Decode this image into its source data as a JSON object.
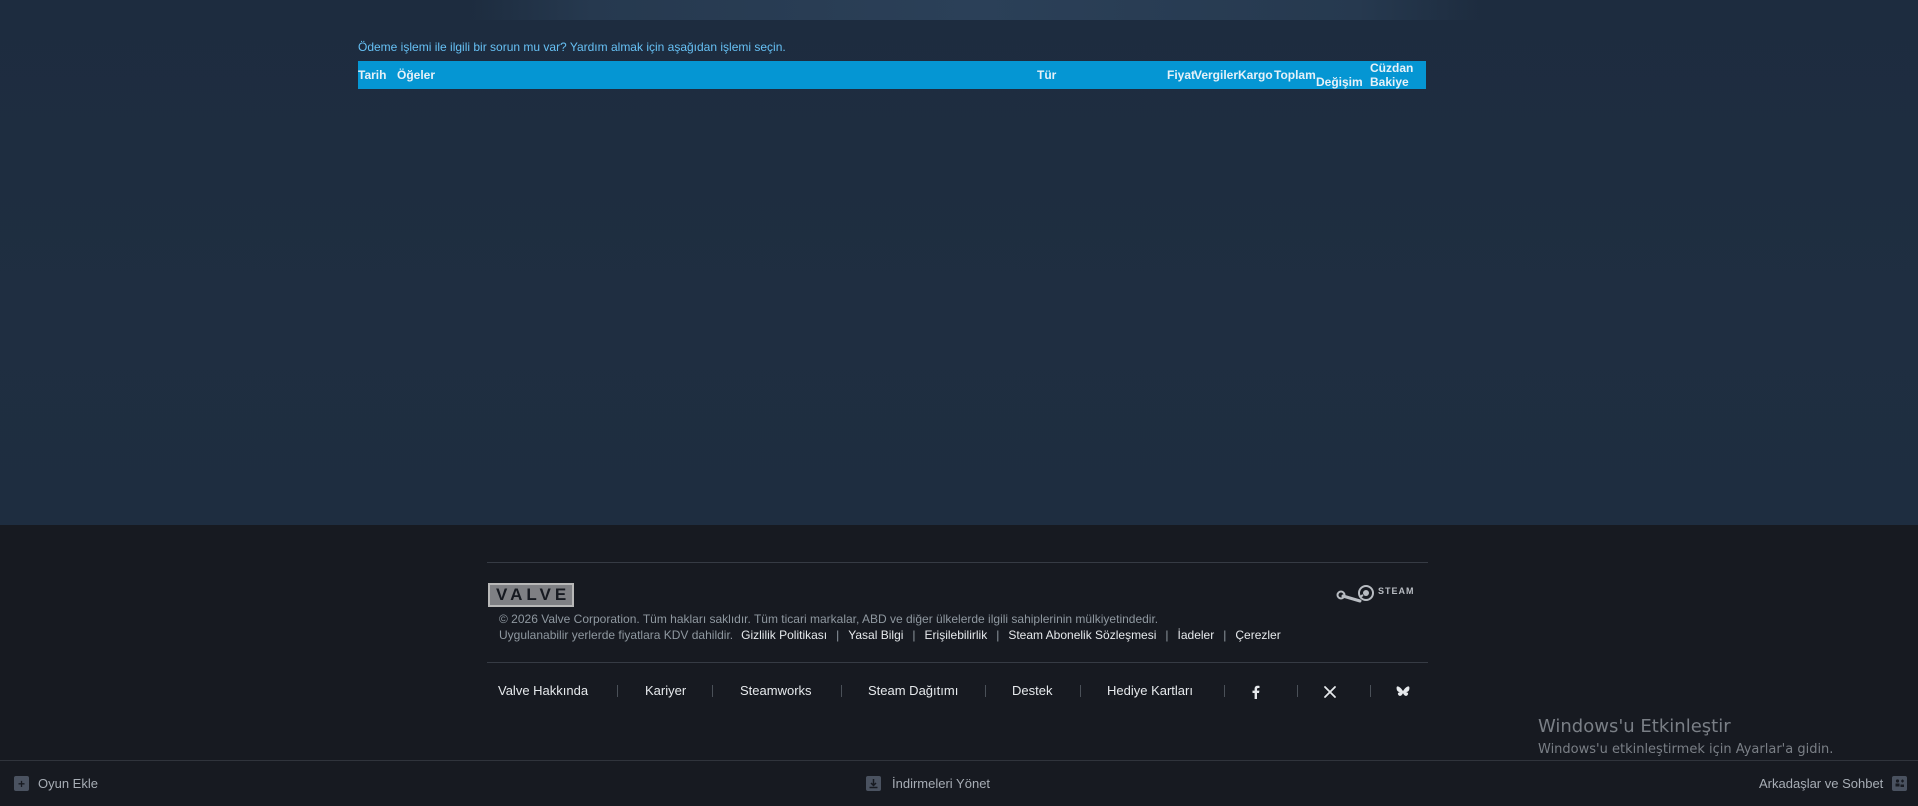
{
  "main": {
    "help_link": "Ödeme işlemi ile ilgili bir sorun mu var? Yardım almak için aşağıdan işlemi seçin.",
    "table_headers": {
      "date": "Tarih",
      "items": "Öğeler",
      "type": "Tür",
      "price": "Fiyat",
      "taxes": "Vergiler",
      "shipping": "Kargo",
      "total": "Toplam",
      "wallet_change_line1": "Cüzdan",
      "wallet_change_line2": "Değişim",
      "wallet_balance": "Bakiye"
    }
  },
  "footer": {
    "valve_logo_text": "VALVE",
    "steam_logo_text": "STEAM",
    "copyright": "© 2026 Valve Corporation. Tüm hakları saklıdır. Tüm ticari markalar, ABD ve diğer ülkelerde ilgili sahiplerinin mülkiyetindedir.",
    "vat_note": "Uygulanabilir yerlerde fiyatlara KDV dahildir.",
    "legal_links": {
      "privacy": "Gizlilik Politikası",
      "legal": "Yasal Bilgi",
      "accessibility": "Erişilebilirlik",
      "subscriber_agreement": "Steam Abonelik Sözleşmesi",
      "refunds": "İadeler",
      "cookies": "Çerezler"
    },
    "nav_links": {
      "about_valve": "Valve Hakkında",
      "careers": "Kariyer",
      "steamworks": "Steamworks",
      "distribution": "Steam Dağıtımı",
      "support": "Destek",
      "gift_cards": "Hediye Kartları"
    },
    "social_icons": [
      "facebook-icon",
      "x-icon",
      "bluesky-icon"
    ]
  },
  "watermark": {
    "title": "Windows'u Etkinleştir",
    "subtitle": "Windows'u etkinleştirmek için Ayarlar'a gidin."
  },
  "bottom_bar": {
    "add_game": "Oyun Ekle",
    "manage_downloads": "İndirmeleri Yönet",
    "friends_chat": "Arkadaşlar ve Sohbet"
  },
  "colors": {
    "background": "#1b2838",
    "table_header": "#0596d3",
    "link": "#66c0f4",
    "footer": "#171a21"
  }
}
